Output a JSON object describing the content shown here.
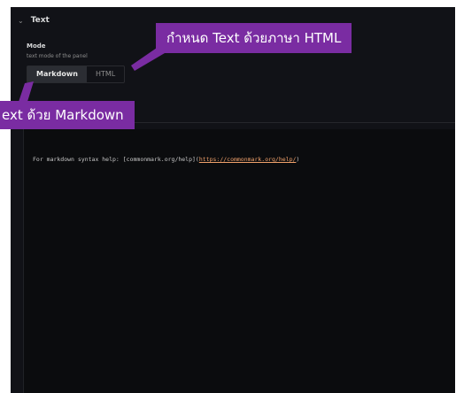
{
  "section": {
    "title": "Text"
  },
  "mode": {
    "label": "Mode",
    "description": "text mode of the panel",
    "options": [
      {
        "label": "Markdown",
        "selected": true
      },
      {
        "label": "HTML",
        "selected": false
      }
    ]
  },
  "editor": {
    "line_prefix": "For markdown syntax help: [commonmark.org/help](",
    "line_link": "https://commonmark.org/help/",
    "line_suffix": ")"
  },
  "callouts": {
    "html": "กำหนด Text ด้วยภาษา HTML",
    "markdown": "ext ด้วย Markdown",
    "color": "#7a2ca2"
  },
  "icons": {
    "collapse": "chevron-down-icon"
  }
}
